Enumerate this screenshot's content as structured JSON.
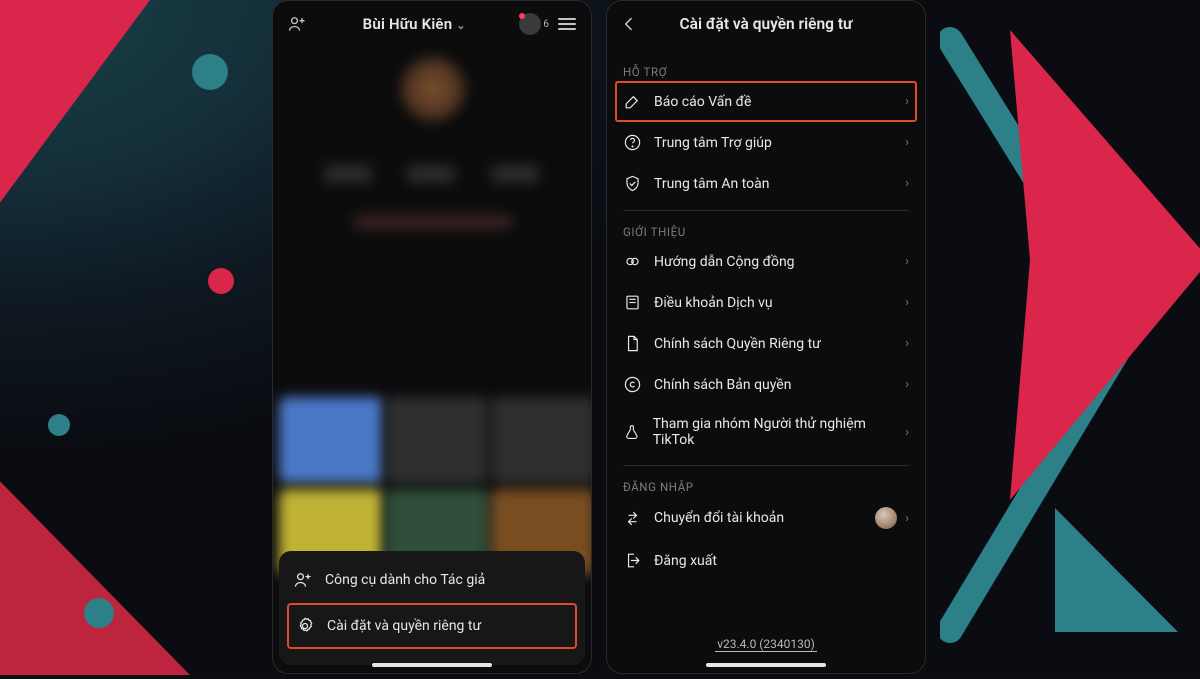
{
  "phone1": {
    "header": {
      "username": "Bùi Hữu Kiên",
      "badge_count": "6"
    },
    "sheet": {
      "items": [
        {
          "label": "Công cụ dành cho Tác giả",
          "icon": "add-user-icon"
        },
        {
          "label": "Cài đặt và quyền riêng tư",
          "icon": "gear-icon",
          "highlight": true
        }
      ]
    }
  },
  "phone2": {
    "title": "Cài đặt và quyền riêng tư",
    "sections": {
      "support": {
        "label": "HỖ TRỢ",
        "items": [
          {
            "label": "Báo cáo Vấn đề",
            "icon": "pencil-icon",
            "highlight": true
          },
          {
            "label": "Trung tâm Trợ giúp",
            "icon": "help-icon"
          },
          {
            "label": "Trung tâm An toàn",
            "icon": "shield-icon"
          }
        ]
      },
      "about": {
        "label": "GIỚI THIỆU",
        "items": [
          {
            "label": "Hướng dẫn Cộng đồng",
            "icon": "link-icon"
          },
          {
            "label": "Điều khoản Dịch vụ",
            "icon": "book-icon"
          },
          {
            "label": "Chính sách Quyền Riêng tư",
            "icon": "document-icon"
          },
          {
            "label": "Chính sách Bản quyền",
            "icon": "copyright-icon"
          },
          {
            "label": "Tham gia nhóm Người thử nghiệm TikTok",
            "icon": "flask-icon"
          }
        ]
      },
      "login": {
        "label": "ĐĂNG NHẬP",
        "switch": "Chuyển đổi tài khoản",
        "logout": "Đăng xuất"
      }
    },
    "version": "v23.4.0 (2340130)"
  }
}
